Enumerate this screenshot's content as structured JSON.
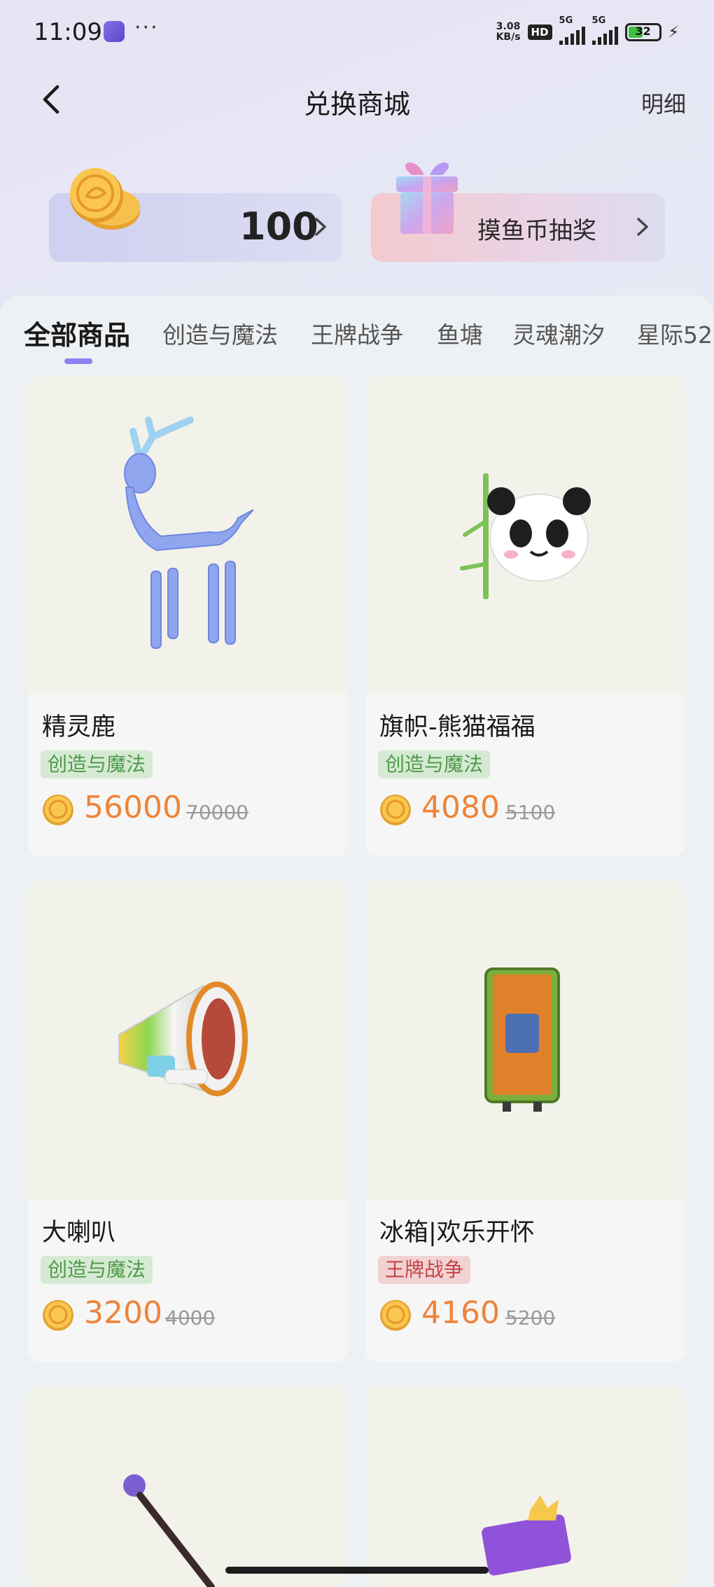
{
  "status_bar": {
    "time": "11:09",
    "more": "···",
    "net_speed_value": "3.08",
    "net_speed_unit": "KB/s",
    "hd": "HD",
    "signal1": "5G",
    "signal2": "5G",
    "battery": "32"
  },
  "header": {
    "title": "兑换商城",
    "detail_label": "明细"
  },
  "balance": {
    "coins": "100"
  },
  "lottery": {
    "label": "摸鱼币抽奖"
  },
  "tabs": [
    {
      "label": "全部商品"
    },
    {
      "label": "创造与魔法"
    },
    {
      "label": "王牌战争"
    },
    {
      "label": "鱼塘"
    },
    {
      "label": "灵魂潮汐"
    },
    {
      "label": "星际52"
    }
  ],
  "products": [
    {
      "name": "精灵鹿",
      "tag": "创造与魔法",
      "price": "56000",
      "original_price": "70000"
    },
    {
      "name": "旗帜-熊猫福福",
      "tag": "创造与魔法",
      "price": "4080",
      "original_price": "5100"
    },
    {
      "name": "大喇叭",
      "tag": "创造与魔法",
      "price": "3200",
      "original_price": "4000"
    },
    {
      "name": "冰箱|欢乐开怀",
      "tag": "王牌战争",
      "price": "4160",
      "original_price": "5200"
    }
  ],
  "colors": {
    "accent": "#8d7ff0",
    "price": "#ef8438",
    "tag_green": "#4f9a4a",
    "tag_red": "#c44545"
  }
}
